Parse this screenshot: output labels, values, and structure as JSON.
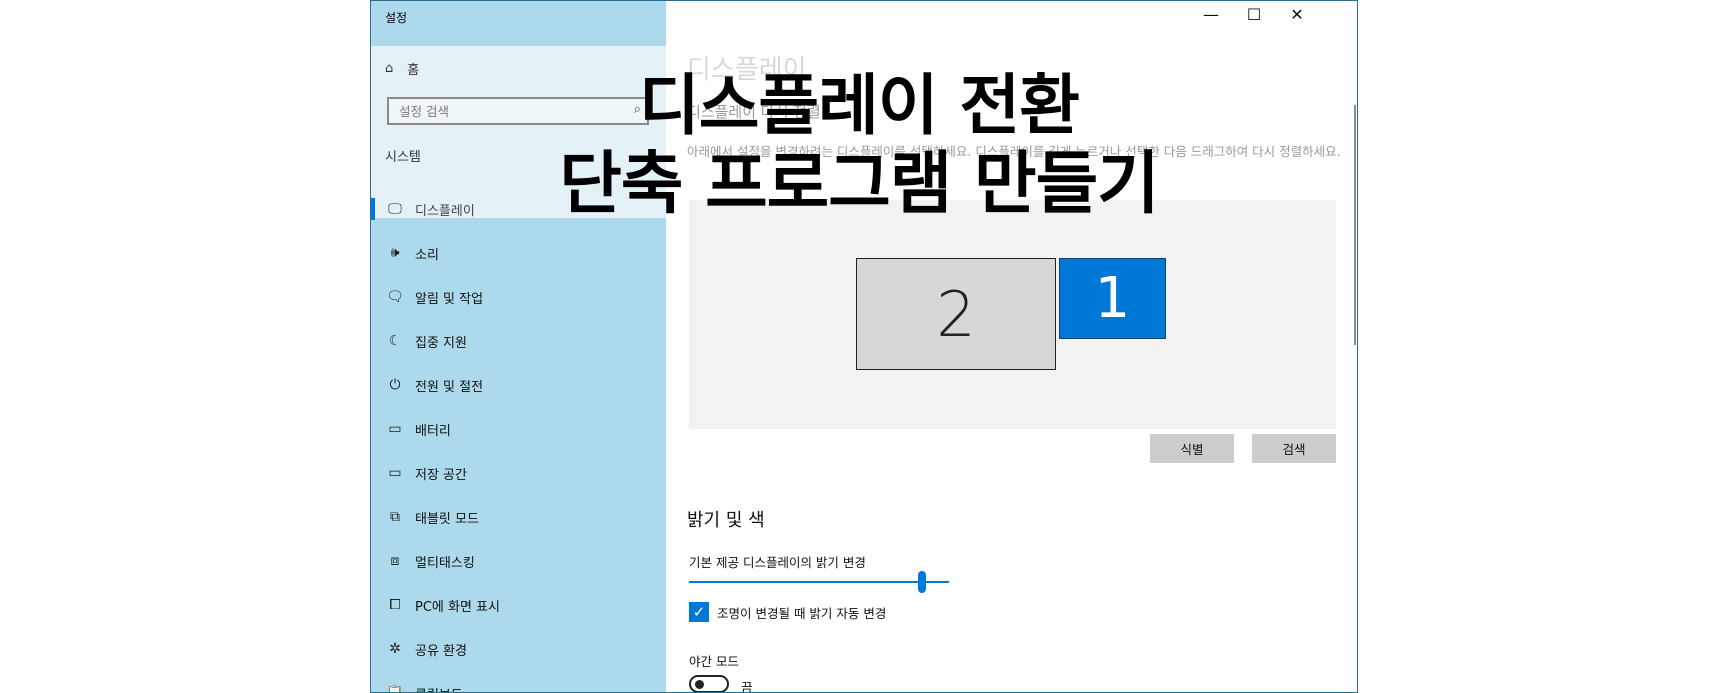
{
  "window": {
    "app_title": "설정",
    "controls": {
      "minimize": "—",
      "maximize": "☐",
      "close": "✕"
    }
  },
  "sidebar": {
    "home_label": "홈",
    "search_placeholder": "설정 검색",
    "section_label": "시스템",
    "items": [
      {
        "label": "디스플레이",
        "icon": "monitor-icon",
        "glyph": "🖵",
        "active": true
      },
      {
        "label": "소리",
        "icon": "speaker-icon",
        "glyph": "🕪"
      },
      {
        "label": "알림 및 작업",
        "icon": "notification-icon",
        "glyph": "🗨"
      },
      {
        "label": "집중 지원",
        "icon": "moon-icon",
        "glyph": "☾"
      },
      {
        "label": "전원 및 절전",
        "icon": "power-icon",
        "glyph": "⏻"
      },
      {
        "label": "배터리",
        "icon": "battery-icon",
        "glyph": "▭"
      },
      {
        "label": "저장 공간",
        "icon": "storage-icon",
        "glyph": "▭"
      },
      {
        "label": "태블릿 모드",
        "icon": "tablet-icon",
        "glyph": "⧉"
      },
      {
        "label": "멀티태스킹",
        "icon": "multitask-icon",
        "glyph": "⧈"
      },
      {
        "label": "PC에 화면 표시",
        "icon": "project-icon",
        "glyph": "⧠"
      },
      {
        "label": "공유 환경",
        "icon": "share-icon",
        "glyph": "✲"
      },
      {
        "label": "클립보드",
        "icon": "clipboard-icon",
        "glyph": "📋"
      }
    ]
  },
  "main": {
    "page_title": "디스플레이",
    "arrange_title": "디스플레이 다시 정렬",
    "arrange_desc": "아래에서 설정을 변경하려는 디스플레이를 선택하세요. 디스플레이를 길게 누르거나 선택한 다음 드래그하여 다시 정렬하세요.",
    "monitors": {
      "secondary": "2",
      "primary": "1"
    },
    "identify_button": "식별",
    "detect_button": "검색",
    "brightness_heading": "밝기 및 색",
    "brightness_label": "기본 제공 디스플레이의 밝기 변경",
    "brightness_value": 1.0,
    "auto_brightness_label": "조명이 변경될 때 밝기 자동 변경",
    "auto_brightness_checked": true,
    "night_mode_label": "야간 모드",
    "night_mode_state": "끔"
  },
  "overlay": {
    "line1": "디스플레이 전환",
    "line2": "단축 프로그램 만들기"
  },
  "colors": {
    "accent": "#0078d7",
    "sidebar": "#add9ec"
  }
}
